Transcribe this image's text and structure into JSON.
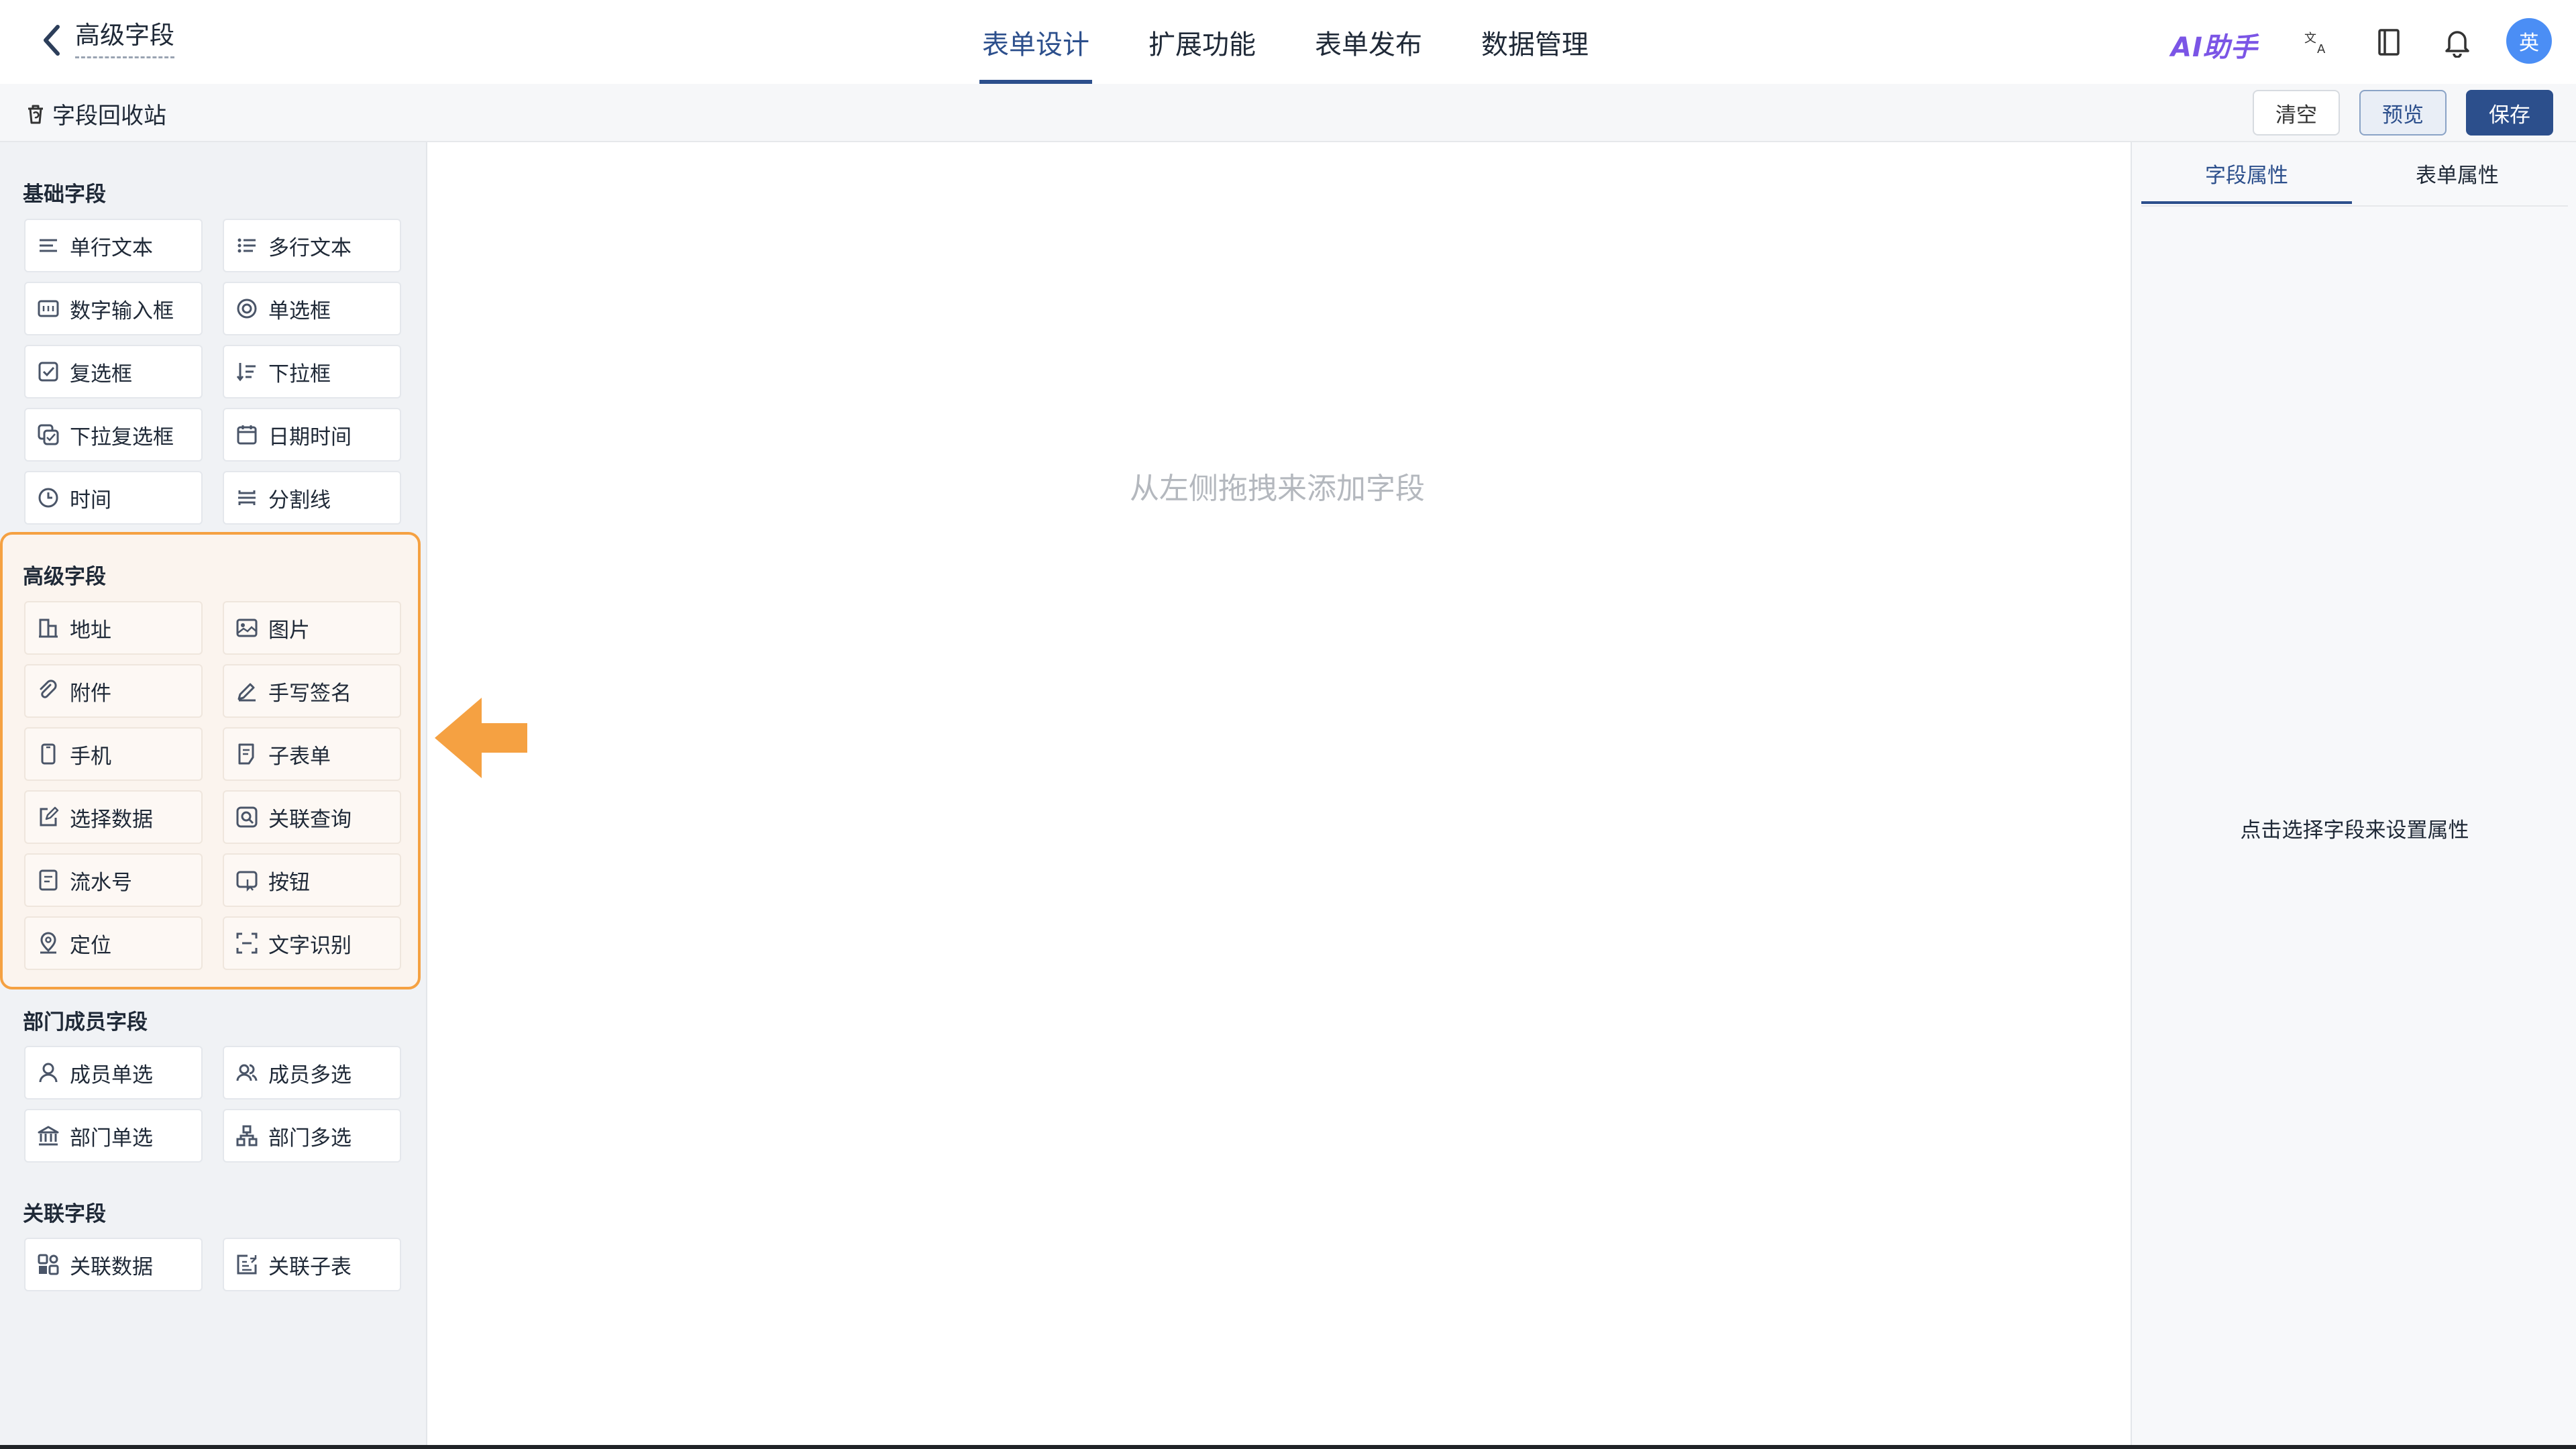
{
  "header": {
    "title": "高级字段",
    "tabs": [
      {
        "label": "表单设计",
        "active": true
      },
      {
        "label": "扩展功能",
        "active": false
      },
      {
        "label": "表单发布",
        "active": false
      },
      {
        "label": "数据管理",
        "active": false
      }
    ],
    "ai_label": "AI助手",
    "avatar_text": "英",
    "icons": [
      "translate-icon",
      "book-icon",
      "bell-icon"
    ]
  },
  "toolbar": {
    "recycle_label": "字段回收站",
    "clear_label": "清空",
    "preview_label": "预览",
    "save_label": "保存"
  },
  "sidebar": {
    "basic": {
      "title": "基础字段",
      "items": [
        {
          "label": "单行文本",
          "icon": "single-line-text-icon"
        },
        {
          "label": "多行文本",
          "icon": "multi-line-text-icon"
        },
        {
          "label": "数字输入框",
          "icon": "number-input-icon"
        },
        {
          "label": "单选框",
          "icon": "radio-icon"
        },
        {
          "label": "复选框",
          "icon": "checkbox-icon"
        },
        {
          "label": "下拉框",
          "icon": "dropdown-icon"
        },
        {
          "label": "下拉复选框",
          "icon": "dropdown-multi-icon"
        },
        {
          "label": "日期时间",
          "icon": "calendar-icon"
        },
        {
          "label": "时间",
          "icon": "clock-icon"
        },
        {
          "label": "分割线",
          "icon": "divider-icon"
        }
      ]
    },
    "advanced": {
      "title": "高级字段",
      "items": [
        {
          "label": "地址",
          "icon": "address-icon"
        },
        {
          "label": "图片",
          "icon": "image-icon"
        },
        {
          "label": "附件",
          "icon": "attachment-icon"
        },
        {
          "label": "手写签名",
          "icon": "signature-icon"
        },
        {
          "label": "手机",
          "icon": "phone-icon"
        },
        {
          "label": "子表单",
          "icon": "subform-icon"
        },
        {
          "label": "选择数据",
          "icon": "select-data-icon"
        },
        {
          "label": "关联查询",
          "icon": "linked-query-icon"
        },
        {
          "label": "流水号",
          "icon": "serial-number-icon"
        },
        {
          "label": "按钮",
          "icon": "button-icon"
        },
        {
          "label": "定位",
          "icon": "location-icon"
        },
        {
          "label": "文字识别",
          "icon": "ocr-icon"
        }
      ]
    },
    "members": {
      "title": "部门成员字段",
      "items": [
        {
          "label": "成员单选",
          "icon": "member-single-icon"
        },
        {
          "label": "成员多选",
          "icon": "member-multi-icon"
        },
        {
          "label": "部门单选",
          "icon": "department-single-icon"
        },
        {
          "label": "部门多选",
          "icon": "department-multi-icon"
        }
      ]
    },
    "related": {
      "title": "关联字段",
      "items": [
        {
          "label": "关联数据",
          "icon": "related-data-icon"
        },
        {
          "label": "关联子表",
          "icon": "related-subtable-icon"
        }
      ]
    }
  },
  "canvas": {
    "empty_hint": "从左侧拖拽来添加字段"
  },
  "right_panel": {
    "tabs": [
      {
        "label": "字段属性",
        "active": true
      },
      {
        "label": "表单属性",
        "active": false
      }
    ],
    "hint": "点击选择字段来设置属性"
  },
  "colors": {
    "primary": "#2c4f8c",
    "highlight": "#f5a142",
    "ai": "#7b55e6",
    "avatar": "#4b8ef5"
  }
}
